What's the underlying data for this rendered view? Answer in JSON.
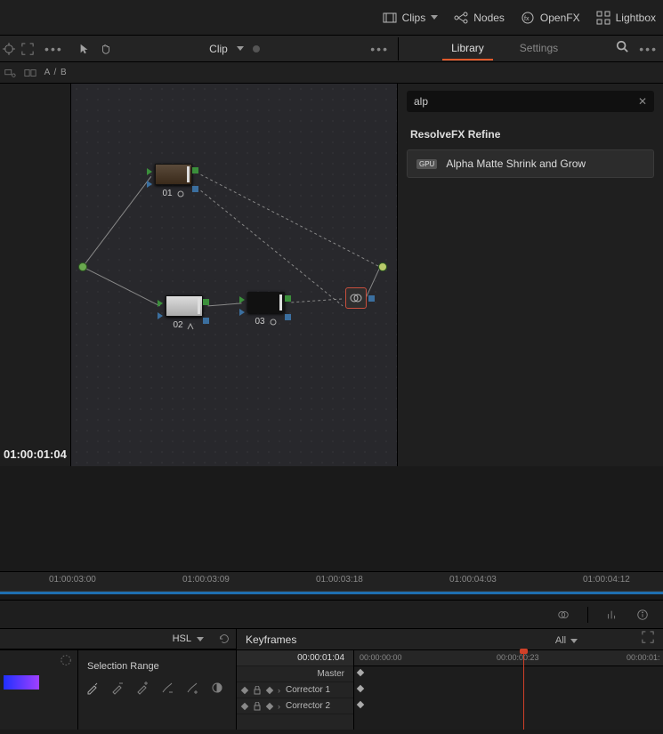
{
  "topbar": {
    "clips": "Clips",
    "nodes": "Nodes",
    "openfx": "OpenFX",
    "lightbox": "Lightbox"
  },
  "midrow": {
    "clip_label": "Clip"
  },
  "subrow": {
    "ab": "A / B"
  },
  "tabs": {
    "library": "Library",
    "settings": "Settings"
  },
  "search": {
    "value": "alp"
  },
  "fx": {
    "category": "ResolveFX Refine",
    "badge": "GPU",
    "item": "Alpha Matte Shrink and Grow"
  },
  "nodes": {
    "n1": "01",
    "n2": "02",
    "n3": "03"
  },
  "timecode": "01:00:01:04",
  "timeline_ticks": [
    "01:00:03:00",
    "01:00:03:09",
    "01:00:03:18",
    "01:00:04:03",
    "01:00:04:12"
  ],
  "keyframes": {
    "title": "Keyframes",
    "all": "All",
    "master_tc": "00:00:01:04",
    "master": "Master",
    "rows": [
      "Corrector 1",
      "Corrector 2"
    ],
    "ruler": [
      "00:00:00:00",
      "00:00:00:23",
      "00:00:01:"
    ]
  },
  "hsl": {
    "label": "HSL",
    "selrange": "Selection Range"
  }
}
